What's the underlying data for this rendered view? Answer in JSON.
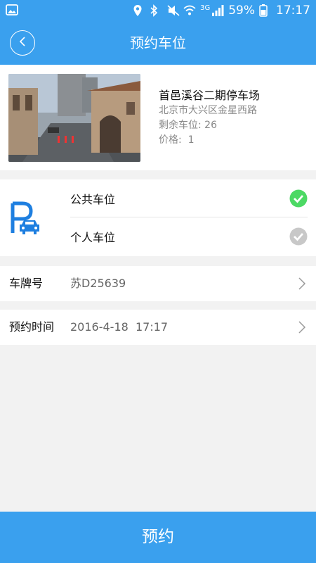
{
  "status_bar": {
    "battery": "59%",
    "network": "3G",
    "time": "17:17"
  },
  "header": {
    "title": "预约车位"
  },
  "parking_lot": {
    "name": "首邑溪谷二期停车场",
    "address": "北京市大兴区金星西路",
    "remaining": "剩余车位: 26",
    "price": "价格:  1"
  },
  "space_types": [
    {
      "label": "公共车位",
      "selected": true
    },
    {
      "label": "个人车位",
      "selected": false
    }
  ],
  "plate": {
    "label": "车牌号",
    "value": "苏D25639"
  },
  "reserve_time": {
    "label": "预约时间",
    "value": "2016-4-18  17:17"
  },
  "submit": {
    "label": "预约"
  },
  "colors": {
    "primary": "#3aa0ee",
    "check_on": "#4cd964",
    "check_off": "#c8c8c8",
    "icon_blue": "#1e7fe0"
  }
}
